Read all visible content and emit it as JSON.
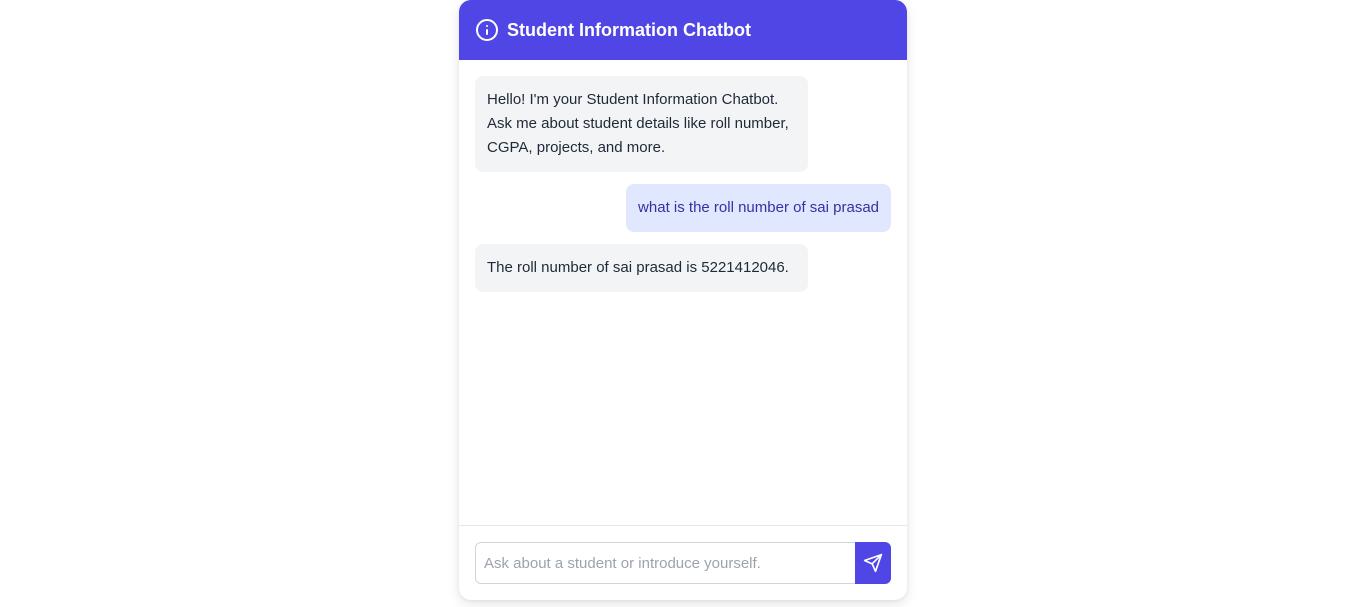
{
  "header": {
    "title": "Student Information Chatbot",
    "icon": "info-circle-icon",
    "color": "#4f46e5"
  },
  "messages": [
    {
      "role": "bot",
      "text": "Hello! I'm your Student Information Chatbot. Ask me about student details like roll number, CGPA, projects, and more."
    },
    {
      "role": "user",
      "text": "what is the roll number of sai prasad"
    },
    {
      "role": "bot",
      "text": "The roll number of sai prasad is 5221412046."
    }
  ],
  "input": {
    "value": "",
    "placeholder": "Ask about a student or introduce yourself."
  },
  "send_button": {
    "icon": "send-icon"
  },
  "colors": {
    "accent": "#4f46e5",
    "bot_bubble": "#f3f4f6",
    "user_bubble": "#e0e7ff",
    "user_text": "#3730a3"
  }
}
